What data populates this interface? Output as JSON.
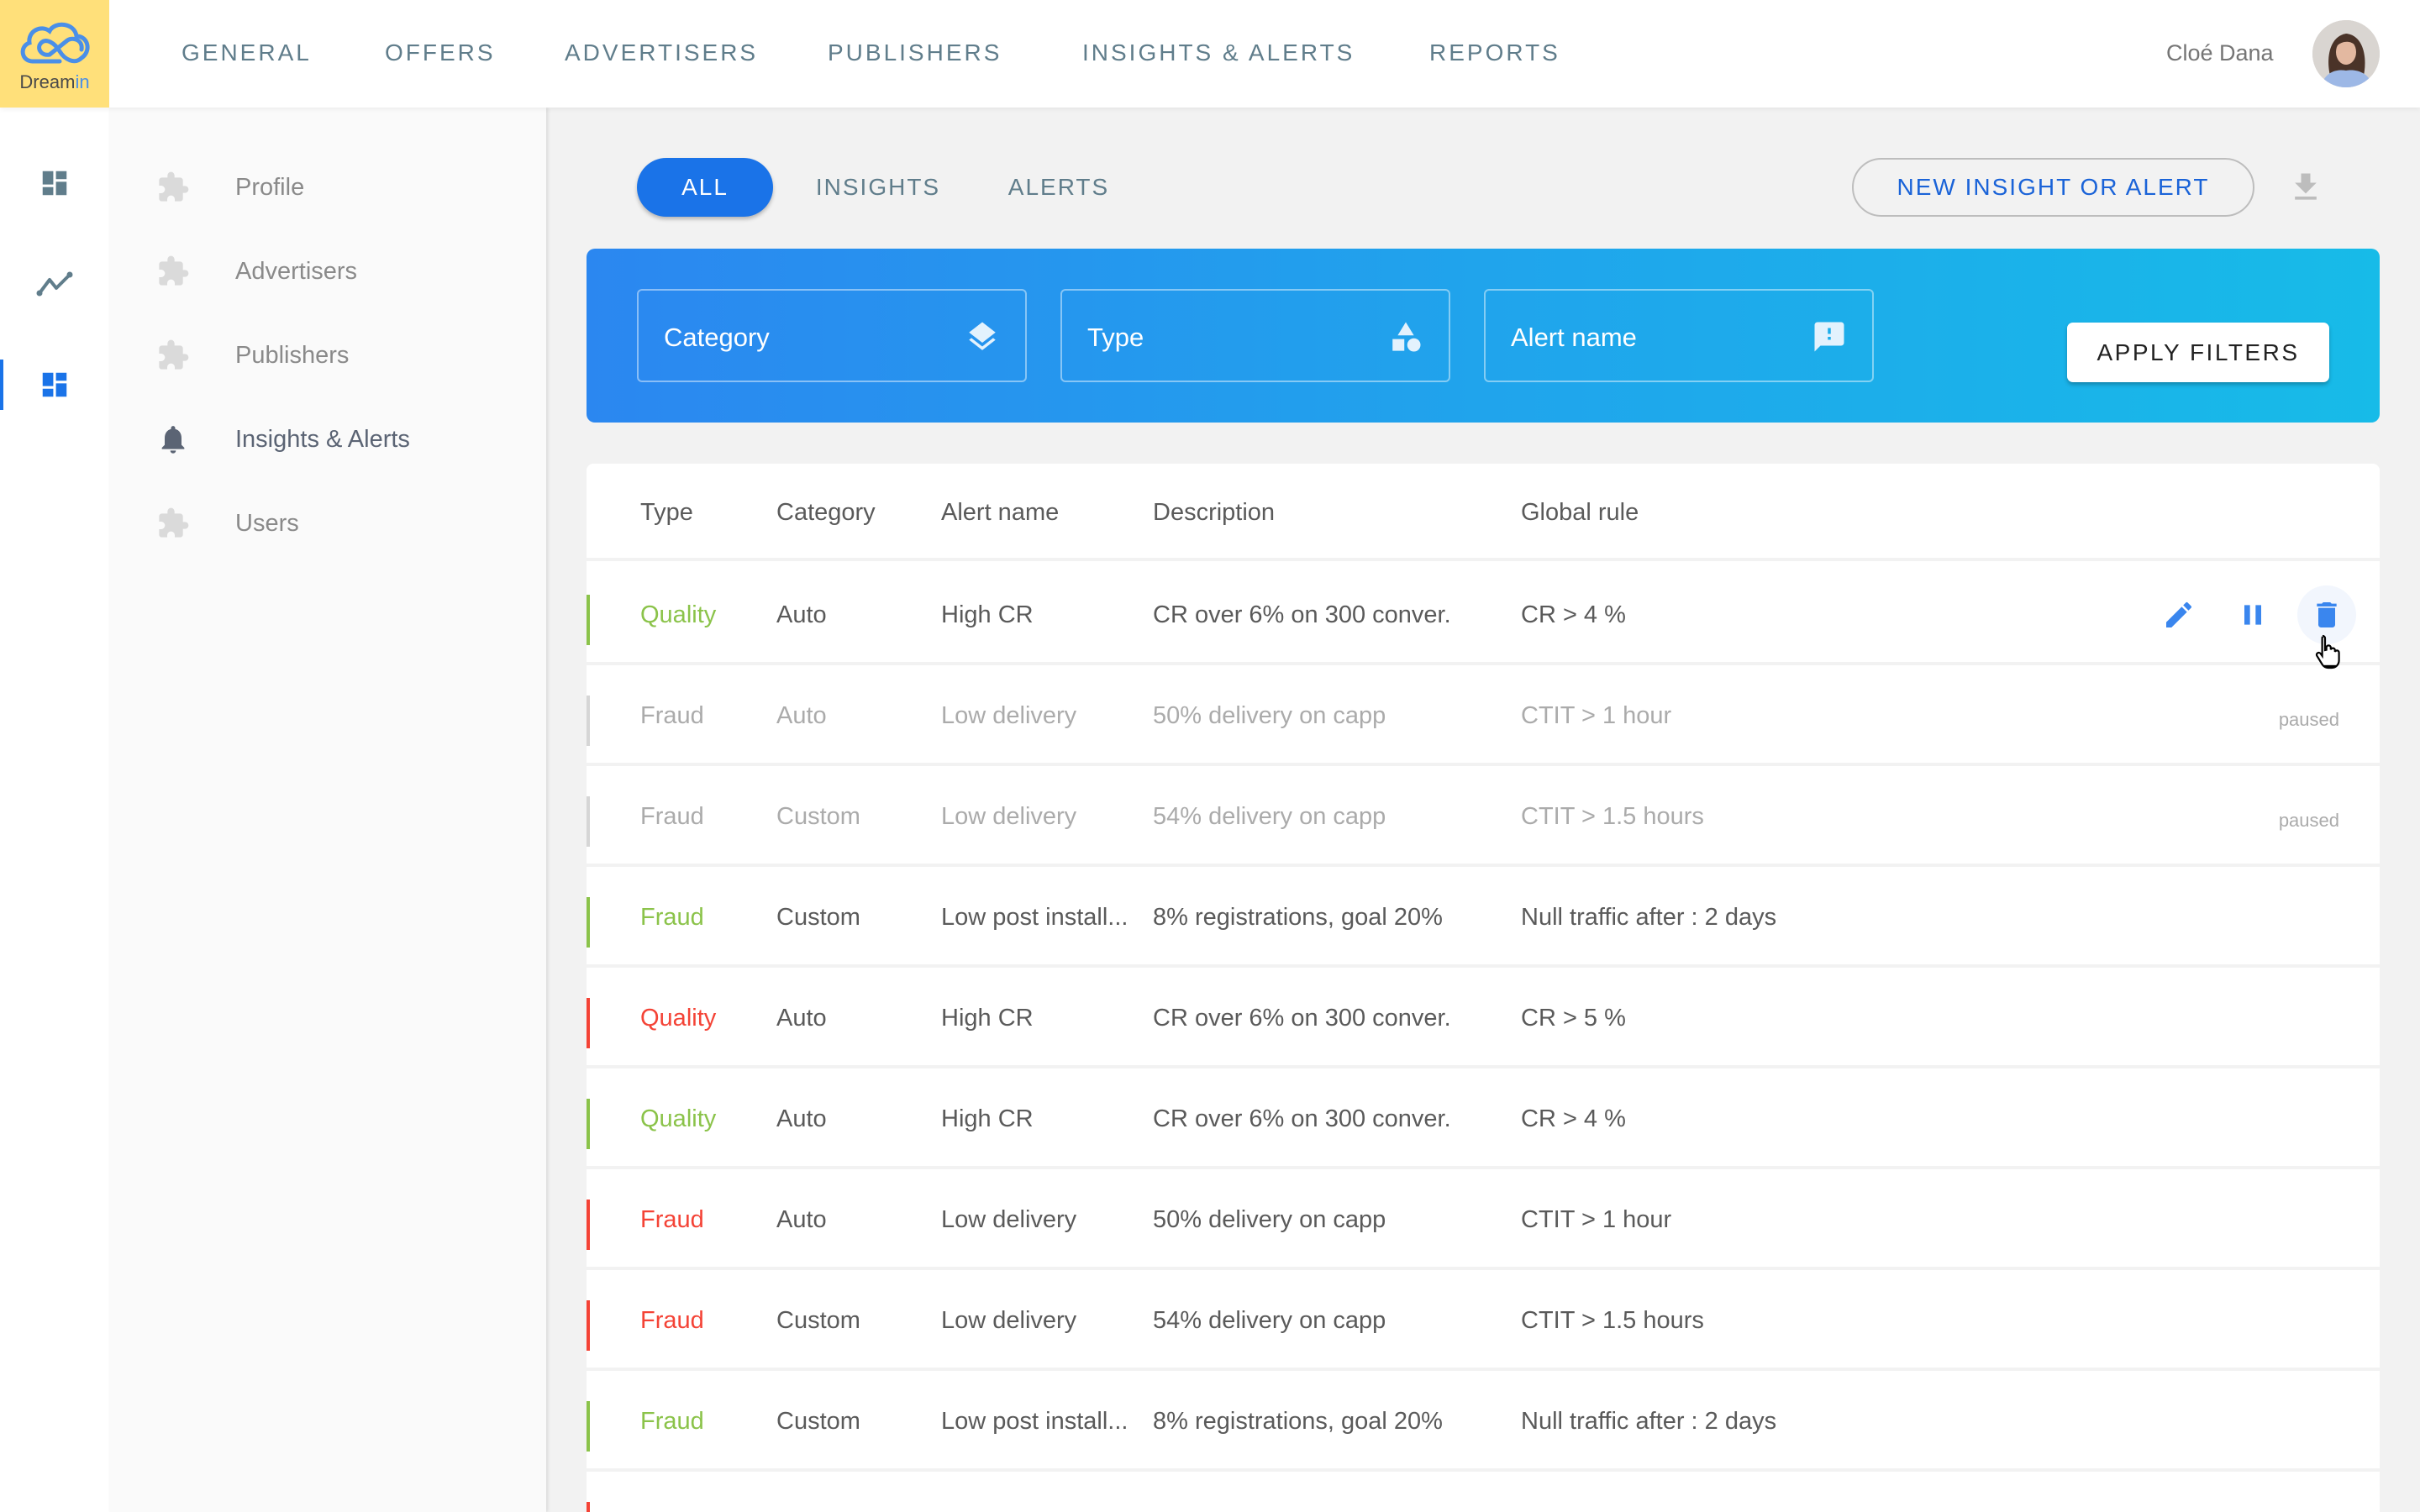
{
  "brand": {
    "name_part1": "Dream",
    "name_part2": "in",
    "logo_bg": "#FFE07A",
    "accent": "#1A73E8"
  },
  "nav": {
    "items": [
      {
        "label": "GENERAL"
      },
      {
        "label": "OFFERS"
      },
      {
        "label": "ADVERTISERS"
      },
      {
        "label": "PUBLISHERS"
      },
      {
        "label": "INSIGHTS & ALERTS"
      },
      {
        "label": "REPORTS"
      }
    ],
    "user_name": "Cloé Dana"
  },
  "rail": {
    "items": [
      {
        "icon": "dashboard-icon",
        "active": false
      },
      {
        "icon": "trending-icon",
        "active": false
      },
      {
        "icon": "dashboard-icon",
        "active": true
      }
    ]
  },
  "submenu": {
    "items": [
      {
        "label": "Profile",
        "icon": "puzzle-icon"
      },
      {
        "label": "Advertisers",
        "icon": "puzzle-icon"
      },
      {
        "label": "Publishers",
        "icon": "puzzle-icon"
      },
      {
        "label": "Insights & Alerts",
        "icon": "bell-icon",
        "active": true
      },
      {
        "label": "Users",
        "icon": "puzzle-icon"
      }
    ]
  },
  "tabs": [
    {
      "label": "ALL",
      "active": true
    },
    {
      "label": "INSIGHTS"
    },
    {
      "label": "ALERTS"
    }
  ],
  "toolbar": {
    "new_label": "NEW INSIGHT OR ALERT",
    "download_icon": "download-icon"
  },
  "filters": {
    "fields": [
      {
        "label": "Category",
        "icon": "layers-icon"
      },
      {
        "label": "Type",
        "icon": "shapes-icon"
      },
      {
        "label": "Alert name",
        "icon": "feedback-icon"
      }
    ],
    "apply_label": "APPLY FILTERS"
  },
  "table": {
    "columns": [
      "Type",
      "Category",
      "Alert name",
      "Description",
      "Global rule"
    ],
    "colors": {
      "green": "#8BC34A",
      "red": "#F44336",
      "grey": "#D6D6D6"
    },
    "rows": [
      {
        "type": "Quality",
        "category": "Auto",
        "alert_name": "High CR",
        "description": "CR over 6% on 300 conver.",
        "rule": "CR > 4 %",
        "color": "green",
        "status": "",
        "actions": true
      },
      {
        "type": "Fraud",
        "category": "Auto",
        "alert_name": "Low delivery",
        "description": "50% delivery on capp",
        "rule": "CTIT > 1 hour",
        "color": "grey",
        "status": "paused"
      },
      {
        "type": "Fraud",
        "category": "Custom",
        "alert_name": "Low delivery",
        "description": "54% delivery on capp",
        "rule": "CTIT > 1.5 hours",
        "color": "grey",
        "status": "paused"
      },
      {
        "type": "Fraud",
        "category": "Custom",
        "alert_name": "Low post install...",
        "description": "8% registrations, goal 20%",
        "rule": "Null traffic after : 2 days",
        "color": "green",
        "status": ""
      },
      {
        "type": "Quality",
        "category": "Auto",
        "alert_name": "High CR",
        "description": "CR over 6% on 300 conver.",
        "rule": "CR > 5 %",
        "color": "red",
        "status": ""
      },
      {
        "type": "Quality",
        "category": "Auto",
        "alert_name": "High CR",
        "description": "CR over 6% on 300 conver.",
        "rule": "CR > 4 %",
        "color": "green",
        "status": ""
      },
      {
        "type": "Fraud",
        "category": "Auto",
        "alert_name": "Low delivery",
        "description": "50% delivery on capp",
        "rule": "CTIT > 1 hour",
        "color": "red",
        "status": ""
      },
      {
        "type": "Fraud",
        "category": "Custom",
        "alert_name": "Low delivery",
        "description": "54% delivery on capp",
        "rule": "CTIT > 1.5 hours",
        "color": "red",
        "status": ""
      },
      {
        "type": "Fraud",
        "category": "Custom",
        "alert_name": "Low post install...",
        "description": "8% registrations, goal 20%",
        "rule": "Null traffic after : 2 days",
        "color": "green",
        "status": ""
      },
      {
        "type": "",
        "category": "",
        "alert_name": "",
        "description": "",
        "rule": "",
        "color": "red",
        "status": ""
      }
    ],
    "row_actions": [
      "edit-icon",
      "pause-icon",
      "delete-icon"
    ]
  }
}
